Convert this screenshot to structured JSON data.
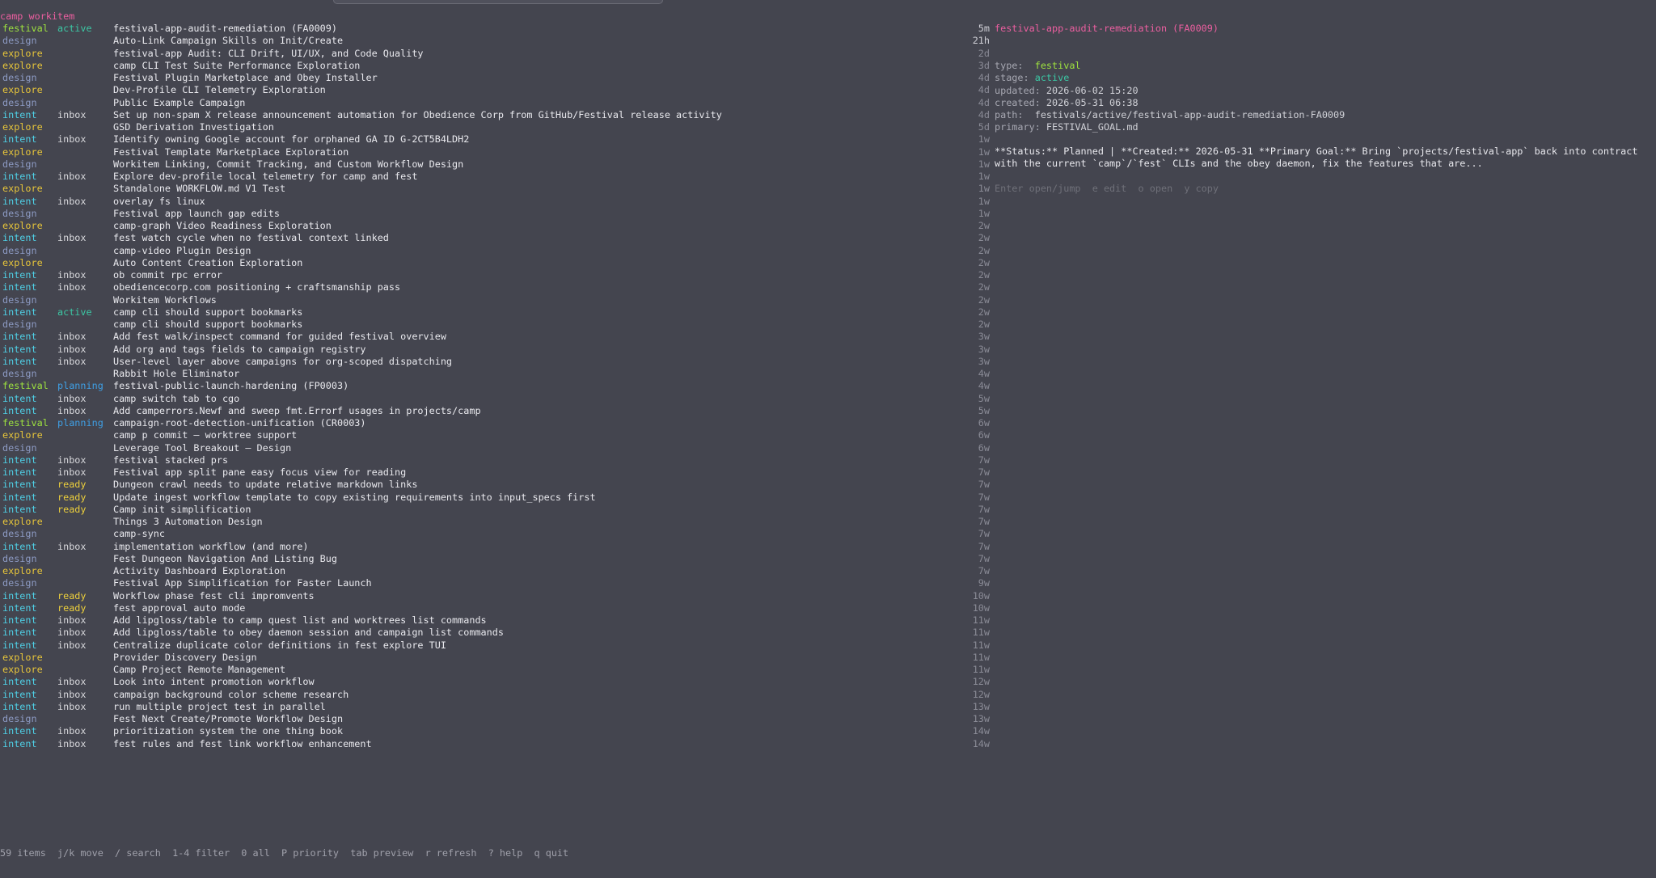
{
  "title": "camp workitem",
  "items": [
    {
      "type": "festival",
      "status": "active",
      "title": "festival-app-audit-remediation (FA0009)",
      "age": "5m"
    },
    {
      "type": "design",
      "status": "",
      "title": "Auto-Link Campaign Skills on Init/Create",
      "age": "21h"
    },
    {
      "type": "explore",
      "status": "",
      "title": "festival-app Audit: CLI Drift, UI/UX, and Code Quality",
      "age": "2d"
    },
    {
      "type": "explore",
      "status": "",
      "title": "camp CLI Test Suite Performance Exploration",
      "age": "3d"
    },
    {
      "type": "design",
      "status": "",
      "title": "Festival Plugin Marketplace and Obey Installer",
      "age": "4d"
    },
    {
      "type": "explore",
      "status": "",
      "title": "Dev-Profile CLI Telemetry Exploration",
      "age": "4d"
    },
    {
      "type": "design",
      "status": "",
      "title": "Public Example Campaign",
      "age": "4d"
    },
    {
      "type": "intent",
      "status": "inbox",
      "title": "Set up non-spam X release announcement automation for Obedience Corp from GitHub/Festival release activity",
      "age": "4d"
    },
    {
      "type": "explore",
      "status": "",
      "title": "GSD Derivation Investigation",
      "age": "5d"
    },
    {
      "type": "intent",
      "status": "inbox",
      "title": "Identify owning Google account for orphaned GA ID G-2CT5B4LDH2",
      "age": "1w"
    },
    {
      "type": "explore",
      "status": "",
      "title": "Festival Template Marketplace Exploration",
      "age": "1w"
    },
    {
      "type": "design",
      "status": "",
      "title": "Workitem Linking, Commit Tracking, and Custom Workflow Design",
      "age": "1w"
    },
    {
      "type": "intent",
      "status": "inbox",
      "title": "Explore dev-profile local telemetry for camp and fest",
      "age": "1w"
    },
    {
      "type": "explore",
      "status": "",
      "title": "Standalone WORKFLOW.md V1 Test",
      "age": "1w"
    },
    {
      "type": "intent",
      "status": "inbox",
      "title": "overlay fs linux",
      "age": "1w"
    },
    {
      "type": "design",
      "status": "",
      "title": "Festival app launch gap edits",
      "age": "1w"
    },
    {
      "type": "explore",
      "status": "",
      "title": "camp-graph Video Readiness Exploration",
      "age": "2w"
    },
    {
      "type": "intent",
      "status": "inbox",
      "title": "fest watch cycle when no festival context linked",
      "age": "2w"
    },
    {
      "type": "design",
      "status": "",
      "title": "camp-video Plugin Design",
      "age": "2w"
    },
    {
      "type": "explore",
      "status": "",
      "title": "Auto Content Creation Exploration",
      "age": "2w"
    },
    {
      "type": "intent",
      "status": "inbox",
      "title": "ob commit rpc error",
      "age": "2w"
    },
    {
      "type": "intent",
      "status": "inbox",
      "title": "obediencecorp.com positioning + craftsmanship pass",
      "age": "2w"
    },
    {
      "type": "design",
      "status": "",
      "title": "Workitem Workflows",
      "age": "2w"
    },
    {
      "type": "intent",
      "status": "active",
      "title": "camp cli should support bookmarks",
      "age": "2w"
    },
    {
      "type": "design",
      "status": "",
      "title": "camp cli should support bookmarks",
      "age": "2w"
    },
    {
      "type": "intent",
      "status": "inbox",
      "title": "Add fest walk/inspect command for guided festival overview",
      "age": "3w"
    },
    {
      "type": "intent",
      "status": "inbox",
      "title": "Add org and tags fields to campaign registry",
      "age": "3w"
    },
    {
      "type": "intent",
      "status": "inbox",
      "title": "User-level layer above campaigns for org-scoped dispatching",
      "age": "3w"
    },
    {
      "type": "design",
      "status": "",
      "title": "Rabbit Hole Eliminator",
      "age": "4w"
    },
    {
      "type": "festival",
      "status": "planning",
      "title": "festival-public-launch-hardening (FP0003)",
      "age": "4w"
    },
    {
      "type": "intent",
      "status": "inbox",
      "title": "camp switch tab to cgo",
      "age": "5w"
    },
    {
      "type": "intent",
      "status": "inbox",
      "title": "Add camperrors.Newf and sweep fmt.Errorf usages in projects/camp",
      "age": "5w"
    },
    {
      "type": "festival",
      "status": "planning",
      "title": "campaign-root-detection-unification (CR0003)",
      "age": "6w"
    },
    {
      "type": "explore",
      "status": "",
      "title": "camp p commit — worktree support",
      "age": "6w"
    },
    {
      "type": "design",
      "status": "",
      "title": "Leverage Tool Breakout — Design",
      "age": "6w"
    },
    {
      "type": "intent",
      "status": "inbox",
      "title": "festival stacked prs",
      "age": "7w"
    },
    {
      "type": "intent",
      "status": "inbox",
      "title": "Festival app split pane easy focus view for reading",
      "age": "7w"
    },
    {
      "type": "intent",
      "status": "ready",
      "title": "Dungeon crawl needs to update relative markdown links",
      "age": "7w"
    },
    {
      "type": "intent",
      "status": "ready",
      "title": "Update ingest workflow template to copy existing requirements into input_specs first",
      "age": "7w"
    },
    {
      "type": "intent",
      "status": "ready",
      "title": "Camp init simplification",
      "age": "7w"
    },
    {
      "type": "explore",
      "status": "",
      "title": "Things 3 Automation Design",
      "age": "7w"
    },
    {
      "type": "design",
      "status": "",
      "title": "camp-sync",
      "age": "7w"
    },
    {
      "type": "intent",
      "status": "inbox",
      "title": "implementation workflow (and more)",
      "age": "7w"
    },
    {
      "type": "design",
      "status": "",
      "title": "Fest Dungeon Navigation And Listing Bug",
      "age": "7w"
    },
    {
      "type": "explore",
      "status": "",
      "title": "Activity Dashboard Exploration",
      "age": "7w"
    },
    {
      "type": "design",
      "status": "",
      "title": "Festival App Simplification for Faster Launch",
      "age": "9w"
    },
    {
      "type": "intent",
      "status": "ready",
      "title": "Workflow phase fest cli impromvents",
      "age": "10w"
    },
    {
      "type": "intent",
      "status": "ready",
      "title": "fest approval auto mode",
      "age": "10w"
    },
    {
      "type": "intent",
      "status": "inbox",
      "title": "Add lipgloss/table to camp quest list and worktrees list commands",
      "age": "11w"
    },
    {
      "type": "intent",
      "status": "inbox",
      "title": "Add lipgloss/table to obey daemon session and campaign list commands",
      "age": "11w"
    },
    {
      "type": "intent",
      "status": "inbox",
      "title": "Centralize duplicate color definitions in fest explore TUI",
      "age": "11w"
    },
    {
      "type": "explore",
      "status": "",
      "title": "Provider Discovery Design",
      "age": "11w"
    },
    {
      "type": "explore",
      "status": "",
      "title": "Camp Project Remote Management",
      "age": "11w"
    },
    {
      "type": "intent",
      "status": "inbox",
      "title": "Look into intent promotion workflow",
      "age": "12w"
    },
    {
      "type": "intent",
      "status": "inbox",
      "title": "campaign background color scheme research",
      "age": "12w"
    },
    {
      "type": "intent",
      "status": "inbox",
      "title": "run multiple project test in parallel",
      "age": "13w"
    },
    {
      "type": "design",
      "status": "",
      "title": "Fest Next Create/Promote Workflow Design",
      "age": "13w"
    },
    {
      "type": "intent",
      "status": "inbox",
      "title": "prioritization system the one thing book",
      "age": "14w"
    },
    {
      "type": "intent",
      "status": "inbox",
      "title": "fest rules and fest link workflow enhancement",
      "age": "14w"
    }
  ],
  "preview": {
    "title": "festival-app-audit-remediation (FA0009)",
    "meta": {
      "type_label": "type:  ",
      "type_value": "festival",
      "stage_label": "stage: ",
      "stage_value": "active",
      "updated_label": "updated: ",
      "updated_value": "2026-06-02 15:20",
      "created_label": "created: ",
      "created_value": "2026-05-31 06:38",
      "path_label": "path:  ",
      "path_value": "festivals/active/festival-app-audit-remediation-FA0009",
      "primary_label": "primary: ",
      "primary_value": "FESTIVAL_GOAL.md"
    },
    "body": "**Status:** Planned | **Created:** 2026-05-31 **Primary Goal:** Bring `projects/festival-app` back into contract with the current `camp`/`fest` CLIs and the obey daemon, fix the features that are...",
    "hints": "Enter open/jump  e edit  o open  y copy"
  },
  "footer": "59 items  j/k move  / search  1-4 filter  0 all  P priority  tab preview  r refresh  ? help  q quit",
  "colors": {
    "background": "#44454f",
    "festival": "#9ee23f",
    "design": "#8d9bc4",
    "explore": "#e7c53a",
    "intent": "#4fd0e6",
    "active": "#3cc7a4",
    "planning": "#3fa0e6",
    "ready": "#eccf3c",
    "title": "#ec5fa0"
  }
}
